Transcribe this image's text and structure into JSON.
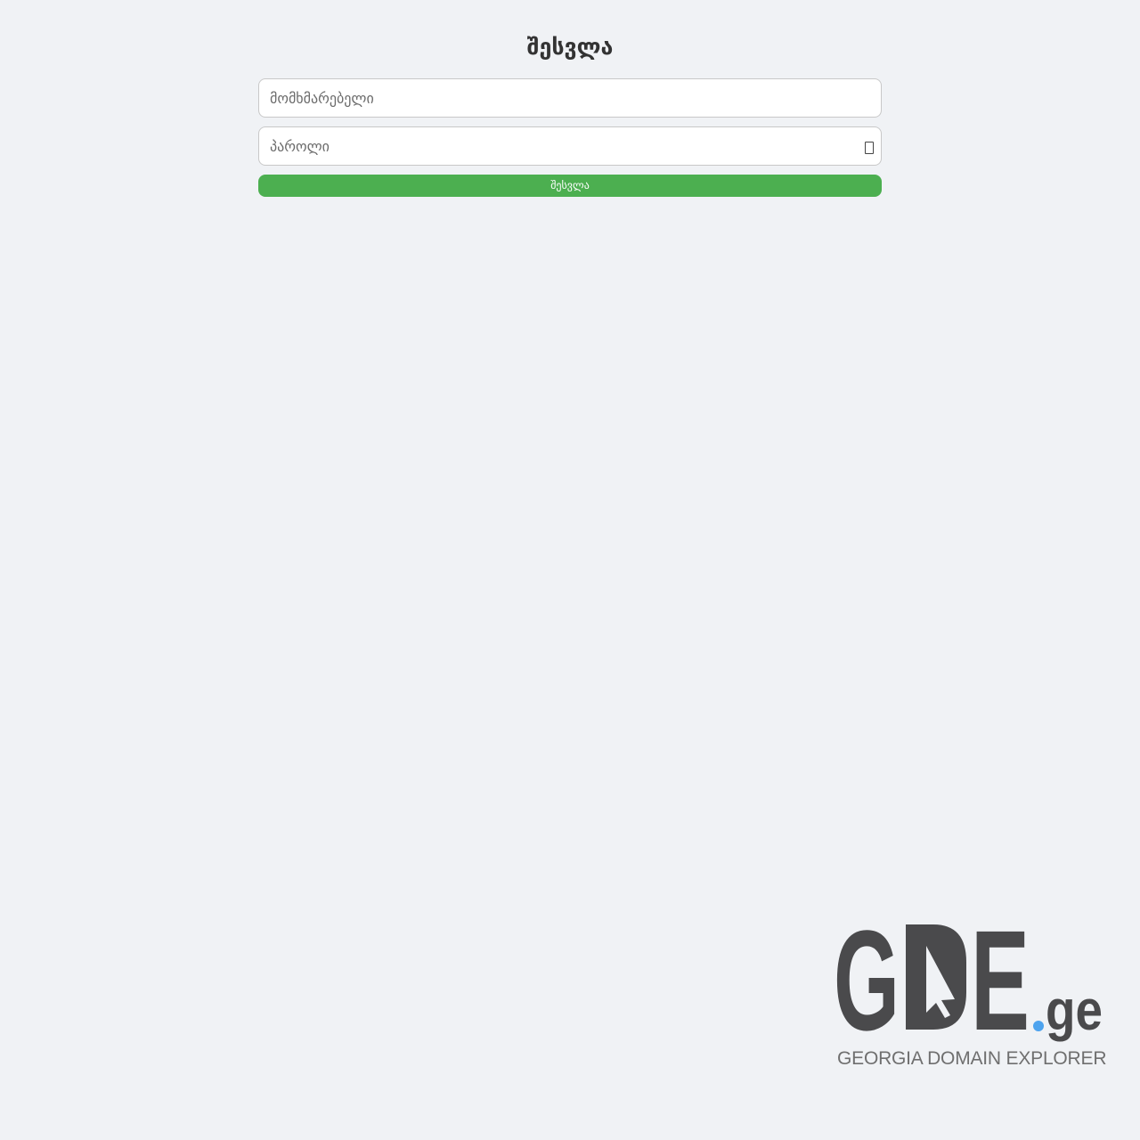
{
  "login": {
    "title": "შესვლა",
    "username_placeholder": "მომხმარებელი",
    "password_placeholder": "პაროლი",
    "submit_label": "შესვლა"
  },
  "brand": {
    "logo_letters": "GDE",
    "logo_suffix": ".ge",
    "tagline": "GEORGIA DOMAIN EXPLORER",
    "colors": {
      "logo_dark": "#4a4a4c",
      "logo_dot": "#4da3ee",
      "tagline": "#6f6f6f"
    }
  },
  "colors": {
    "background": "#f0f2f5",
    "primary_button": "#4caf50",
    "input_border": "#c8c8c8"
  },
  "icons": {
    "password_toggle": "eye-icon"
  }
}
